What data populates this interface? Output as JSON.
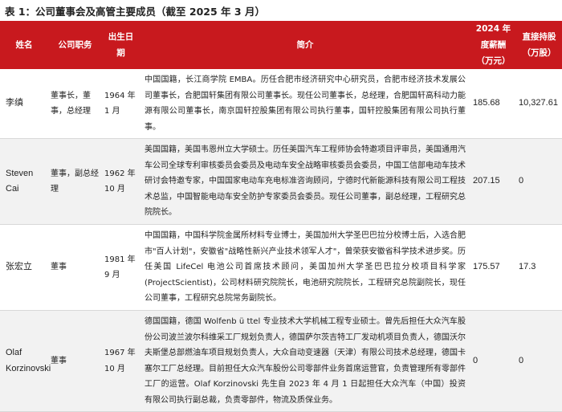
{
  "caption": "表 1：公司董事会及高管主要成员（截至 2025 年 3 月）",
  "headers": {
    "name": "姓名",
    "role": "公司职务",
    "birth": "出生日期",
    "bio": "简介",
    "salary": "2024 年度薪酬（万元）",
    "shares": "直接持股（万股）"
  },
  "rows": [
    {
      "name": "李缜",
      "role": "董事长，董事，总经理",
      "birth": "1964 年 1 月",
      "bio": "中国国籍，长江商学院 EMBA。历任合肥市经济研究中心研究员，合肥市经济技术发展公司董事长，合肥国轩集团有限公司董事长。现任公司董事长，总经理，合肥国轩高科动力能源有限公司董事长，南京国轩控股集团有限公司执行董事，国轩控股集团有限公司执行董事。",
      "salary": "185.68",
      "shares": "10,327.61"
    },
    {
      "name": "Steven Cai",
      "role": "董事，副总经理",
      "birth": "1962 年 10 月",
      "bio": "美国国籍，美国韦恩州立大学硕士。历任美国汽车工程师协会特邀项目评审员，美国通用汽车公司全球专利审核委员会委员及电动车安全战略审核委员会委员，中国工信部电动车技术研讨会特邀专家，中国国家电动车充电标准咨询顾问，宁德时代新能源科技有限公司工程技术总监，中国智能电动车安全防护专家委员会委员。现任公司董事，副总经理，工程研究总院院长。",
      "salary": "207.15",
      "shares": "0"
    },
    {
      "name": "张宏立",
      "role": "董事",
      "birth": "1981 年 9 月",
      "bio": "中国国籍，中国科学院金属所材料专业博士，美国加州大学圣巴巴拉分校博士后，入选合肥市\"百人计划\"，安徽省\"战略性新兴产业技术领军人才\"，曾荣获安徽省科学技术进步奖。历任美国 LifeCel 电池公司首席技术顾问，美国加州大学圣巴巴拉分校项目科学家(ProjectScientist)，公司材料研究院院长，电池研究院院长，工程研究总院副院长，现任公司董事，工程研究总院常务副院长。",
      "salary": "175.57",
      "shares": "17.3"
    },
    {
      "name": "Olaf Korzinovski",
      "role": "董事",
      "birth": "1967 年 10 月",
      "bio": "德国国籍，德国 Wolfenb ü ttel 专业技术大学机械工程专业硕士。曾先后担任大众汽车股份公司波兰波尔科维采工厂规划负责人，德国萨尔茨吉特工厂发动机项目负责人，德国沃尔夫斯堡总部燃油车项目规划负责人，大众自动变速器（天津）有限公司技术总经理，德国卡塞尔工厂总经理。目前担任大众汽车股份公司零部件业务首席运营官，负责管理所有零部件工厂的运营。Olaf Korzinovski 先生自 2023 年 4 月 1 日起担任大众汽车（中国）投资有限公司执行副总裁，负责零部件，物流及质保业务。",
      "salary": "0",
      "shares": "0"
    }
  ]
}
